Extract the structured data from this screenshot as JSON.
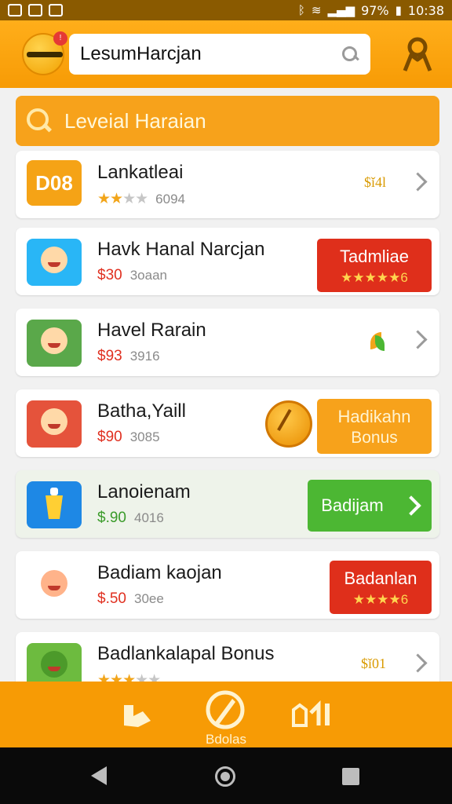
{
  "status_bar": {
    "icons": [
      "notification-icon",
      "notification-icon",
      "notification-icon",
      "bluetooth-icon",
      "data-icon",
      "wifi-icon",
      "signal-icon",
      "battery-icon"
    ],
    "battery": "97%",
    "time": "10:38"
  },
  "header": {
    "search_value": "LesumHarcjan",
    "search_icon": "magnifier-icon",
    "profile_icon": "user-icon",
    "logo_icon": "smiley-logo-icon"
  },
  "section": {
    "title": "Leveial Haraian"
  },
  "items": [
    {
      "thumb_text": "D08",
      "name": "Lankatleai",
      "rating": 2,
      "meta": "6094",
      "tag": "$ǐ4l"
    },
    {
      "name": "Havk Hanal Narcjan",
      "price": "$30",
      "meta": "3oaan",
      "button_label": "Tadmliae",
      "button_rating_text": "★★★★★6"
    },
    {
      "name": "Havel Rarain",
      "price": "$93",
      "meta": "3916"
    },
    {
      "name": "Batha,Yaill",
      "price": "$90",
      "meta": "3085",
      "button_label": "Hadikahn",
      "button_sub": "Bonus"
    },
    {
      "name": "Lanoienam",
      "price": "$.90",
      "meta": "4016",
      "button_label": "Badijam"
    },
    {
      "name": "Badiam kaojan",
      "price": "$.50",
      "meta": "30ee",
      "button_label": "Badanlan",
      "button_rating_text": "★★★★6"
    },
    {
      "name": "Badlankalapal Bonus",
      "rating": 3,
      "tag": "$ǐ01"
    }
  ],
  "bottom_nav": {
    "label": "Bdolas",
    "icons": [
      "tag-icon",
      "compass-icon",
      "chart-icon"
    ]
  },
  "colors": {
    "accent": "#f79b05",
    "red_button": "#df2f1b",
    "green_button": "#4cb733",
    "price_red": "#e03020"
  }
}
